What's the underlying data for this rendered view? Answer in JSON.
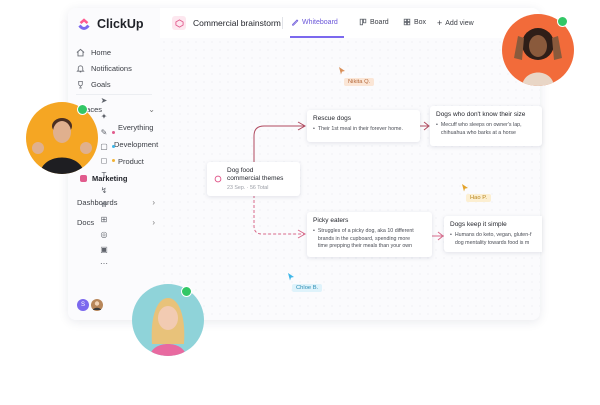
{
  "app": {
    "logo_text": "ClickUp",
    "brand_colors": {
      "accent": "#7b68ee",
      "pink": "#e15b8d",
      "online": "#32c766"
    }
  },
  "sidebar": {
    "items": [
      {
        "label": "Home",
        "icon": "home-icon"
      },
      {
        "label": "Notifications",
        "icon": "bell-icon"
      },
      {
        "label": "Goals",
        "icon": "trophy-icon"
      }
    ],
    "spaces_label": "Spaces",
    "spaces": [
      {
        "label": "Everything"
      },
      {
        "label": "Development"
      },
      {
        "label": "Product"
      },
      {
        "label": "Marketing"
      }
    ],
    "dashboards_label": "Dashboards",
    "docs_label": "Docs",
    "user_initial": "S"
  },
  "topbar": {
    "title": "Commercial brainstorm",
    "tabs": [
      {
        "label": "Whiteboard",
        "icon": "whiteboard-icon",
        "active": true
      },
      {
        "label": "Board",
        "icon": "board-icon",
        "active": false
      },
      {
        "label": "Box",
        "icon": "box-icon",
        "active": false
      },
      {
        "label": "Add view",
        "icon": "plus-icon",
        "active": false
      }
    ]
  },
  "whiteboard": {
    "center_card": {
      "title_line1": "Dog food",
      "title_line2": "commercial themes",
      "meta": "23 Sep. · 56 Total"
    },
    "cards": [
      {
        "title": "Rescue dogs",
        "body": "Their 1st meal in their forever home."
      },
      {
        "title": "Dogs who don't know their size",
        "body_line1": "Mecuff who sleeps on owner's lap,",
        "body_line2": "chihuahua who barks at a horse"
      },
      {
        "title": "Picky eaters",
        "body_line1": "Struggles of a picky dog, aka 10 different",
        "body_line2": "brands in the cupboard, spending more",
        "body_line3": "time prepping their meals than your own"
      },
      {
        "title": "Dogs keep it simple",
        "body_line1": "Humans do keto, vegan, gluten-f",
        "body_line2": "dog mentality towards food is m"
      }
    ],
    "cursors": [
      {
        "name": "Nikita Q."
      },
      {
        "name": "Hao P."
      },
      {
        "name": "Chloe B."
      }
    ]
  }
}
